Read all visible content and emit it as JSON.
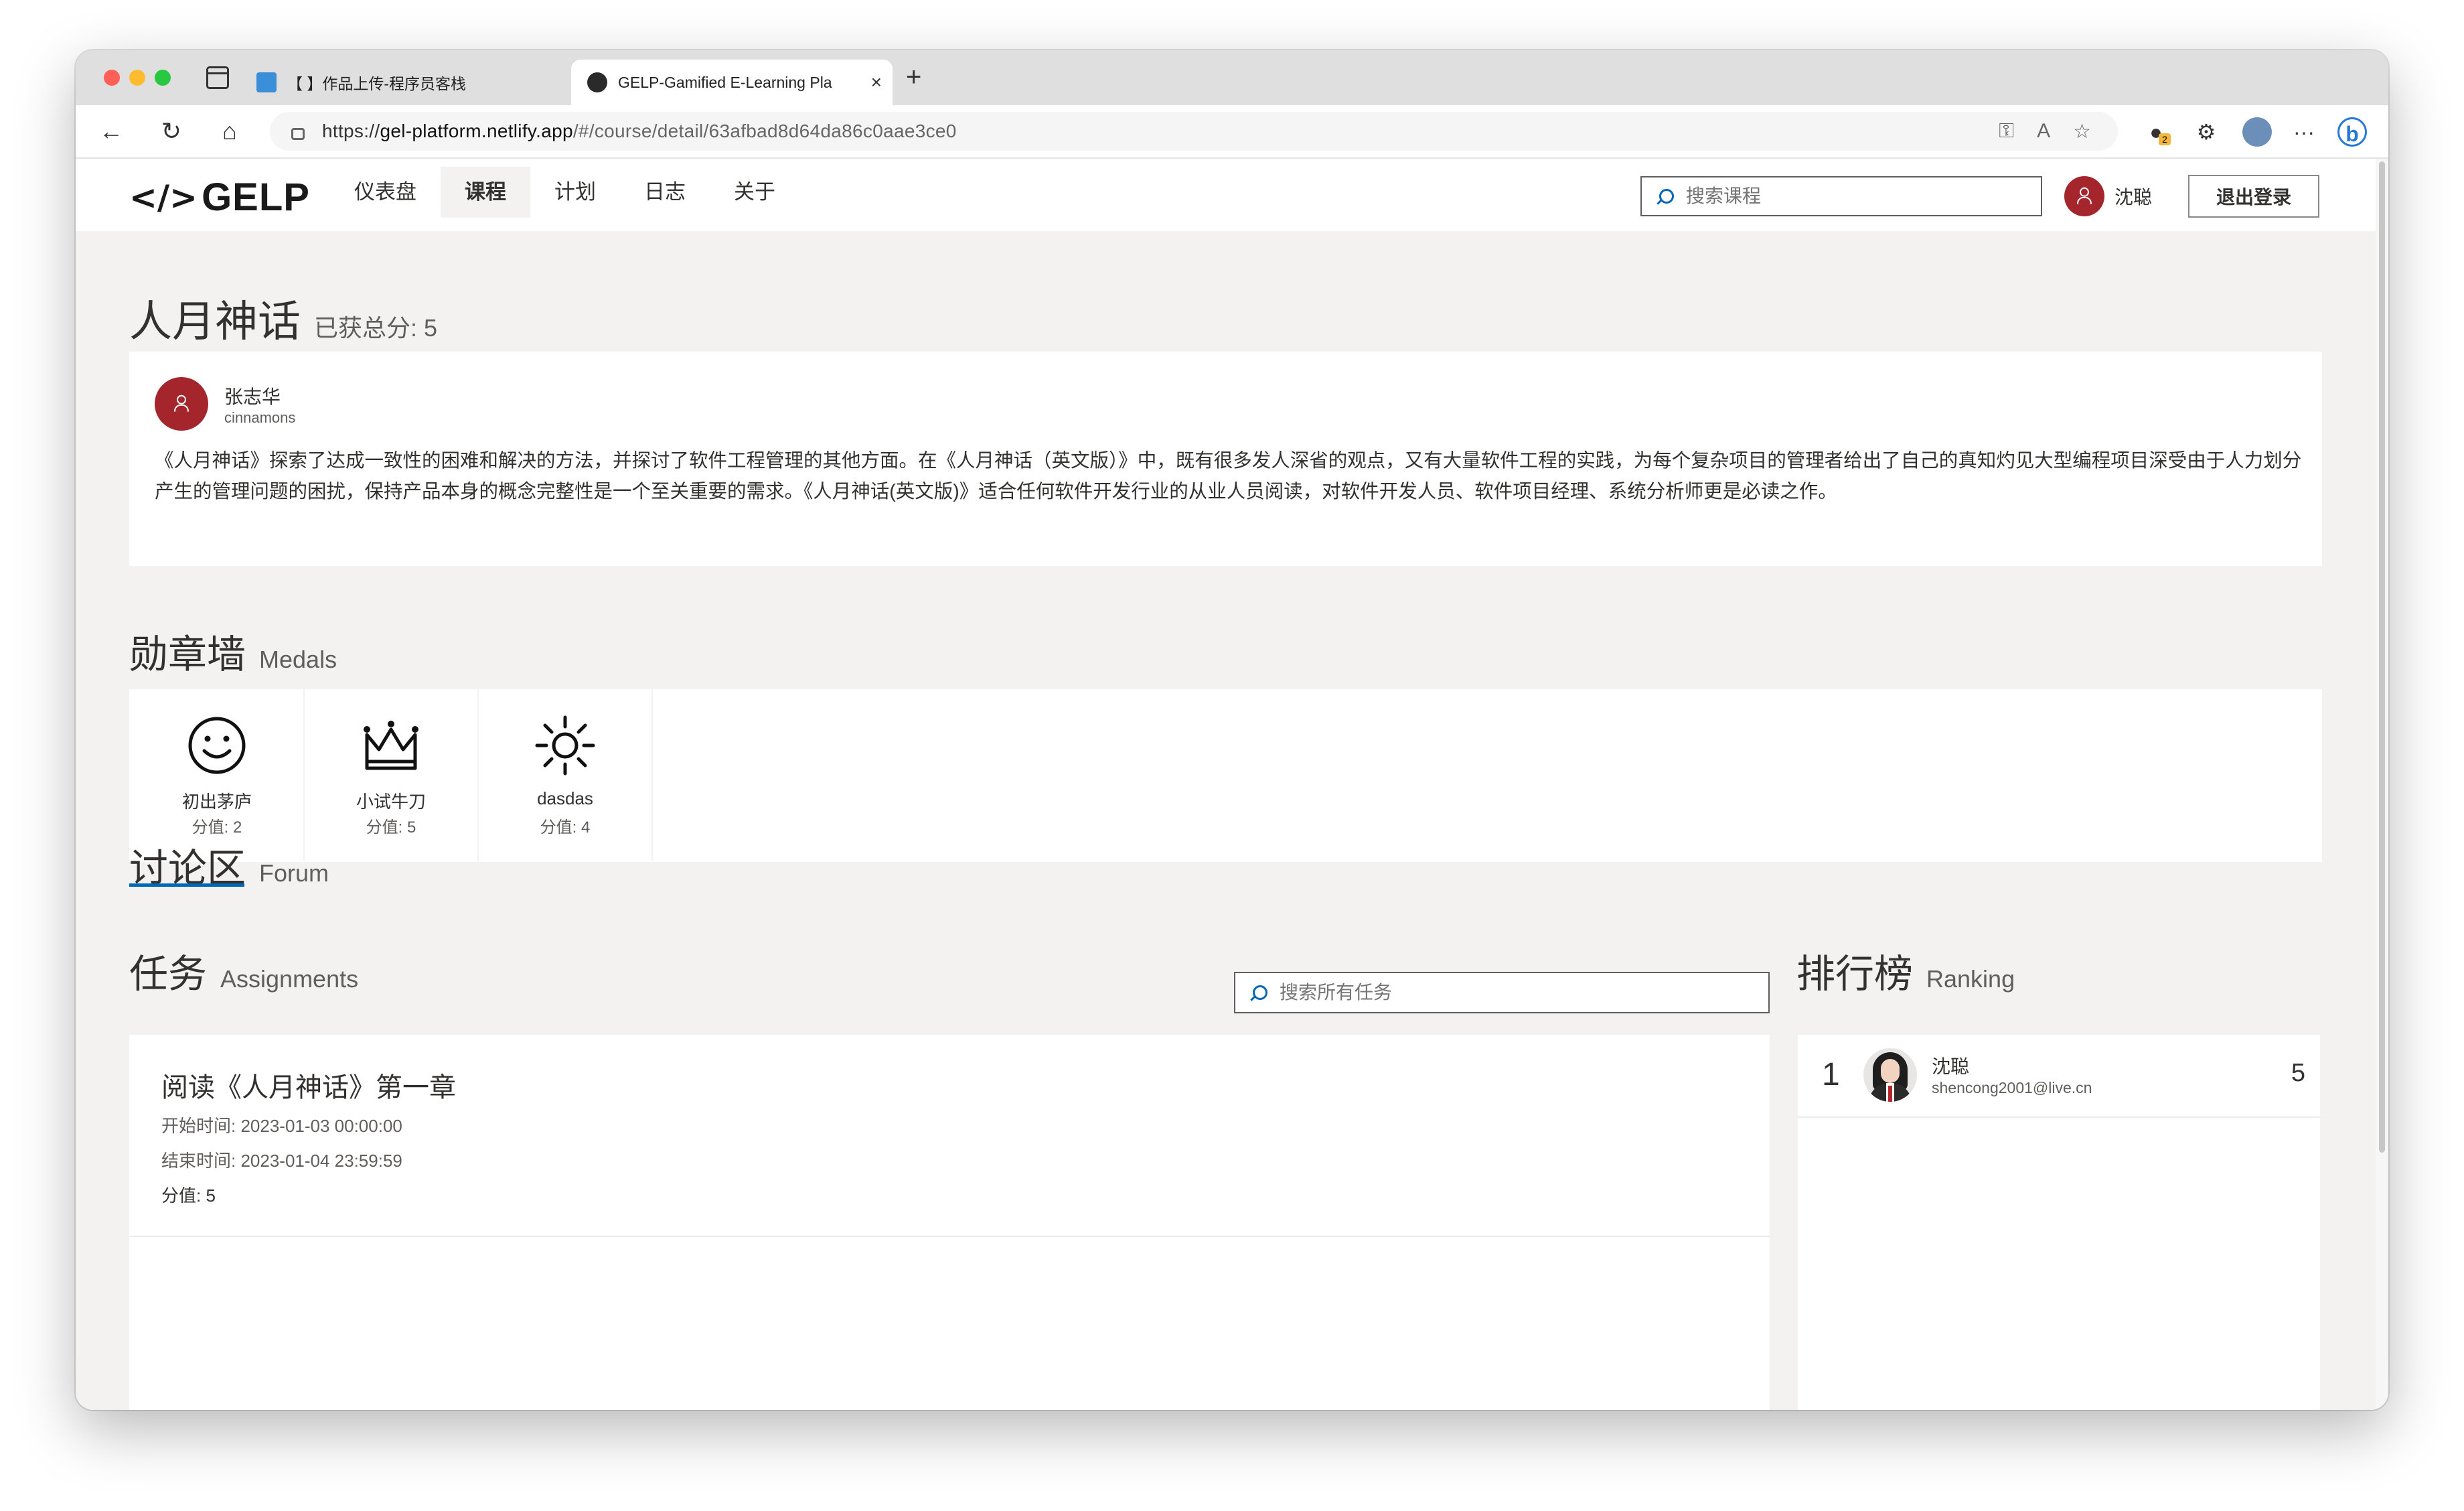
{
  "browser": {
    "tabs": [
      {
        "title": "【          】作品上传-程序员客栈",
        "active": false
      },
      {
        "title": "GELP-Gamified E-Learning Pla",
        "active": true
      }
    ],
    "address": {
      "scheme": "https://",
      "domain": "gel-platform.netlify.app",
      "path": "/#/course/detail/63afbad8d64da86c0aae3ce0"
    },
    "extension_badge": "2"
  },
  "app": {
    "logo_text": "GELP",
    "logo_mark": "</>",
    "nav": [
      {
        "label": "仪表盘",
        "selected": false
      },
      {
        "label": "课程",
        "selected": true
      },
      {
        "label": "计划",
        "selected": false
      },
      {
        "label": "日志",
        "selected": false
      },
      {
        "label": "关于",
        "selected": false
      }
    ],
    "search_placeholder": "搜索课程",
    "user_name": "沈聪",
    "logout_label": "退出登录"
  },
  "course": {
    "title": "人月神话",
    "total_score": "已获总分: 5",
    "author_name": "张志华",
    "author_handle": "cinnamons",
    "description": "《人月神话》探索了达成一致性的困难和解决的方法，并探讨了软件工程管理的其他方面。在《人月神话（英文版）》中，既有很多发人深省的观点，又有大量软件工程的实践，为每个复杂项目的管理者给出了自己的真知灼见大型编程项目深受由于人力划分产生的管理问题的困扰，保持产品本身的概念完整性是一个至关重要的需求。《人月神话(英文版)》适合任何软件开发行业的从业人员阅读，对软件开发人员、软件项目经理、系统分析师更是必读之作。"
  },
  "medals": {
    "title": "勋章墙",
    "subtitle": "Medals",
    "items": [
      {
        "name": "初出茅庐",
        "score": "分值: 2",
        "icon": "smiley-icon"
      },
      {
        "name": "小试牛刀",
        "score": "分值: 5",
        "icon": "crown-icon"
      },
      {
        "name": "dasdas",
        "score": "分值: 4",
        "icon": "sun-icon"
      }
    ]
  },
  "forum": {
    "title": "讨论区",
    "subtitle": "Forum"
  },
  "assignments": {
    "title": "任务",
    "subtitle": "Assignments",
    "search_placeholder": "搜索所有任务",
    "items": [
      {
        "title": "阅读《人月神话》第一章",
        "start": "开始时间: 2023-01-03 00:00:00",
        "end": "结束时间: 2023-01-04 23:59:59",
        "score": "分值: 5"
      }
    ]
  },
  "ranking": {
    "title": "排行榜",
    "subtitle": "Ranking",
    "items": [
      {
        "rank": "1",
        "name": "沈聪",
        "email": "shencong2001@live.cn",
        "score": "5"
      }
    ]
  },
  "colors": {
    "accent": "#0067b8",
    "avatar_red": "#a4262c",
    "page_bg": "#f3f2f1"
  }
}
